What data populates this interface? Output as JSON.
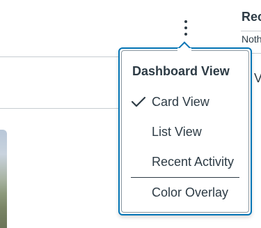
{
  "sidebar_peek": {
    "title": "Rec",
    "subtitle": "Noth",
    "fragment": "V"
  },
  "options_button": {
    "icon": "kebab-vertical-icon"
  },
  "dashboard_menu": {
    "heading": "Dashboard View",
    "items": [
      {
        "label": "Card View",
        "selected": true,
        "icon": "checkmark-icon"
      },
      {
        "label": "List View",
        "selected": false
      },
      {
        "label": "Recent Activity",
        "selected": false
      }
    ],
    "extra_item": {
      "label": "Color Overlay"
    }
  },
  "colors": {
    "accent_border": "#0374b5",
    "text": "#2d3b45",
    "divider": "#c7cdd1"
  }
}
